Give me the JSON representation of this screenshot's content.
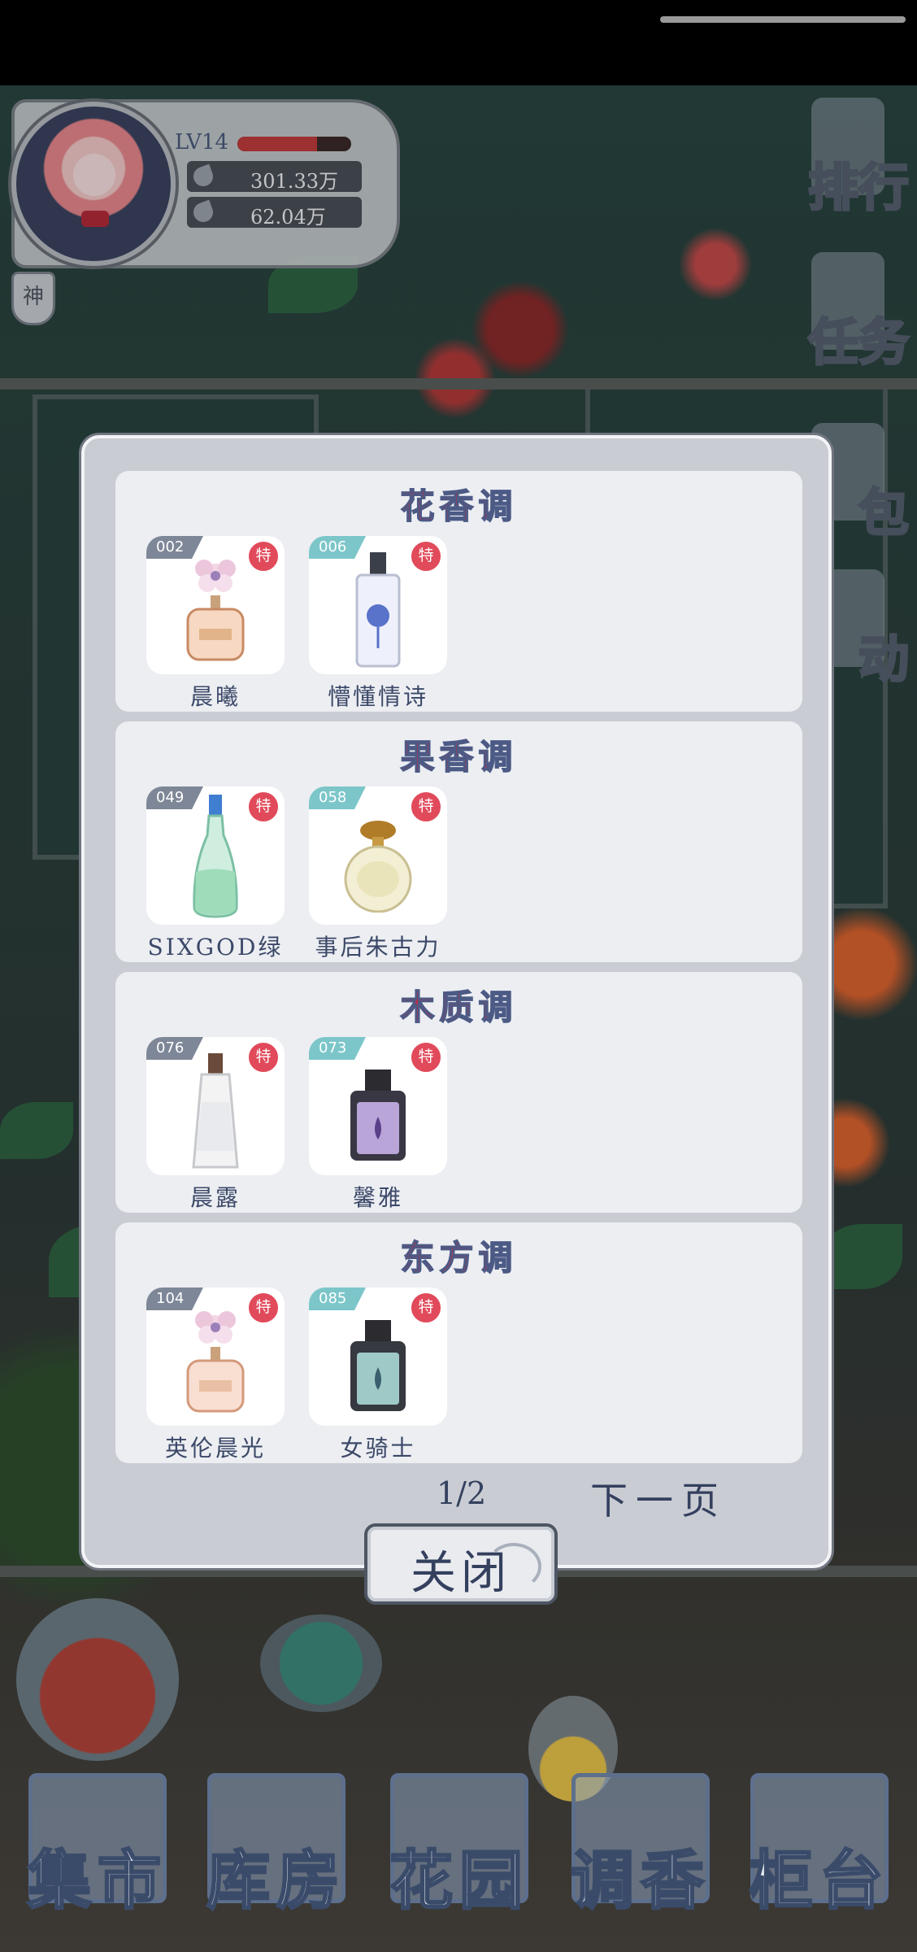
{
  "player": {
    "level": "LV14",
    "exp_fraction": 0.7,
    "currency_1": "301.33万",
    "currency_2": "62.04万",
    "badge": "神"
  },
  "side_menu": [
    {
      "label": "排行"
    },
    {
      "label": "任务"
    },
    {
      "label": "包"
    },
    {
      "label": "动"
    }
  ],
  "dialog": {
    "categories": [
      {
        "title": "花香调",
        "items": [
          {
            "number": "002",
            "badge": "特",
            "name": "晨曦",
            "tag_color": "#7e8797"
          },
          {
            "number": "006",
            "badge": "特",
            "name": "懵懂情诗",
            "tag_color": "#7cc6c9"
          }
        ]
      },
      {
        "title": "果香调",
        "items": [
          {
            "number": "049",
            "badge": "特",
            "name": "SIXGOD绿",
            "tag_color": "#7e8797"
          },
          {
            "number": "058",
            "badge": "特",
            "name": "事后朱古力",
            "tag_color": "#7cc6c9"
          }
        ]
      },
      {
        "title": "木质调",
        "items": [
          {
            "number": "076",
            "badge": "特",
            "name": "晨露",
            "tag_color": "#7e8797"
          },
          {
            "number": "073",
            "badge": "特",
            "name": "馨雅",
            "tag_color": "#7cc6c9"
          }
        ]
      },
      {
        "title": "东方调",
        "items": [
          {
            "number": "104",
            "badge": "特",
            "name": "英伦晨光",
            "tag_color": "#7e8797"
          },
          {
            "number": "085",
            "badge": "特",
            "name": "女骑士",
            "tag_color": "#7cc6c9"
          }
        ]
      }
    ],
    "pager": "1/2",
    "next_label": "下一页",
    "close_label": "关闭"
  },
  "bottom_nav": [
    {
      "label": "集市"
    },
    {
      "label": "库房"
    },
    {
      "label": "花园"
    },
    {
      "label": "调香"
    },
    {
      "label": "柜台"
    }
  ]
}
